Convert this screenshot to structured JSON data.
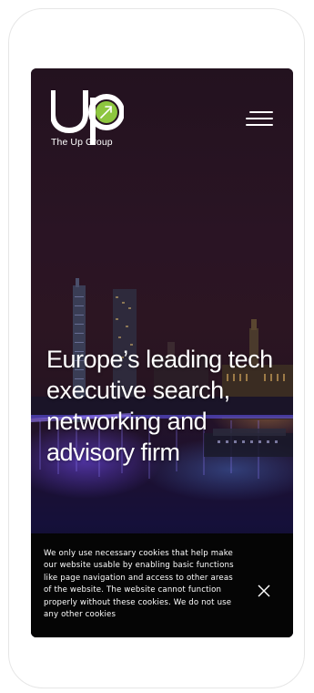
{
  "brand": {
    "logo_text": "Up",
    "caption": "The Up Group",
    "logo_accent_color": "#8dc63f",
    "logo_icon": "arrow-up-right-icon"
  },
  "header": {
    "menu_icon": "hamburger-menu-icon"
  },
  "hero": {
    "headline": "Europe’s leading tech executive search, networking and advisory firm",
    "background": "london-night-skyline"
  },
  "cookie_banner": {
    "message": "We only use necessary cookies that help make our website usable by enabling basic functions like page navigation and access to other areas of the website. The website cannot function properly without these cookies. We do not use any other cookies",
    "close_icon": "close-icon"
  },
  "colors": {
    "cookie_background": "#050505",
    "text": "#ffffff",
    "frame_border": "#e6e6e6"
  }
}
